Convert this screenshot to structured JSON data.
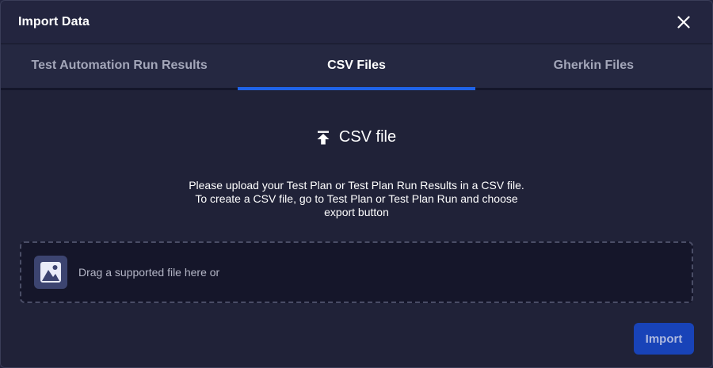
{
  "dialog": {
    "title": "Import Data",
    "close_icon": "close-icon"
  },
  "tabs": [
    {
      "label": "Test Automation Run Results",
      "active": false
    },
    {
      "label": "CSV Files",
      "active": true
    },
    {
      "label": "Gherkin Files",
      "active": false
    }
  ],
  "upload": {
    "icon": "upload-icon",
    "heading": "CSV file",
    "instructions_line1": "Please upload your Test Plan or Test Plan Run Results in a CSV file.",
    "instructions_line2": "To create a CSV file, go to Test Plan or Test Plan Run and choose",
    "instructions_line3": "export button"
  },
  "dropzone": {
    "icon": "image-icon",
    "text": "Drag a supported file here or"
  },
  "footer": {
    "import_label": "Import"
  },
  "colors": {
    "background": "#23253f",
    "accent": "#1f63e8",
    "button": "#1843b8"
  }
}
